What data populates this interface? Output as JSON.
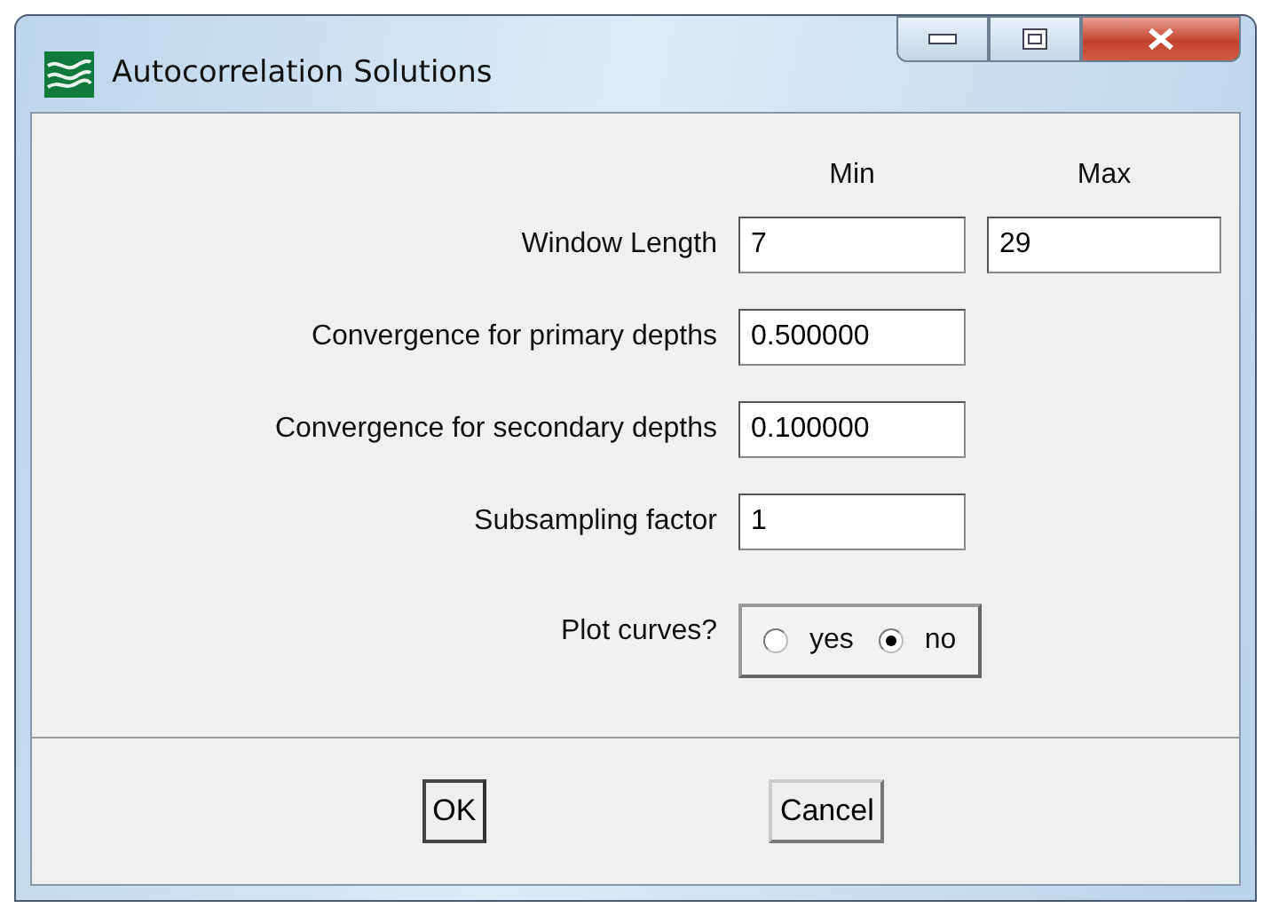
{
  "window": {
    "title": "Autocorrelation Solutions"
  },
  "columns": [
    "Min",
    "Max"
  ],
  "fields": [
    {
      "kind": "range",
      "label": "Window Length",
      "min": "7",
      "max": "29"
    },
    {
      "kind": "text",
      "label": "Convergence for primary depths",
      "value": "0.500000"
    },
    {
      "kind": "text",
      "label": "Convergence for secondary depths",
      "value": "0.100000"
    },
    {
      "kind": "text",
      "label": "Subsampling factor",
      "value": "1"
    },
    {
      "kind": "radio",
      "label": "Plot curves?",
      "options": [
        {
          "label": "yes",
          "selected": false
        },
        {
          "label": "no",
          "selected": true
        }
      ]
    }
  ],
  "buttons": [
    {
      "label": "OK",
      "default": true
    },
    {
      "label": "Cancel",
      "default": false
    }
  ]
}
